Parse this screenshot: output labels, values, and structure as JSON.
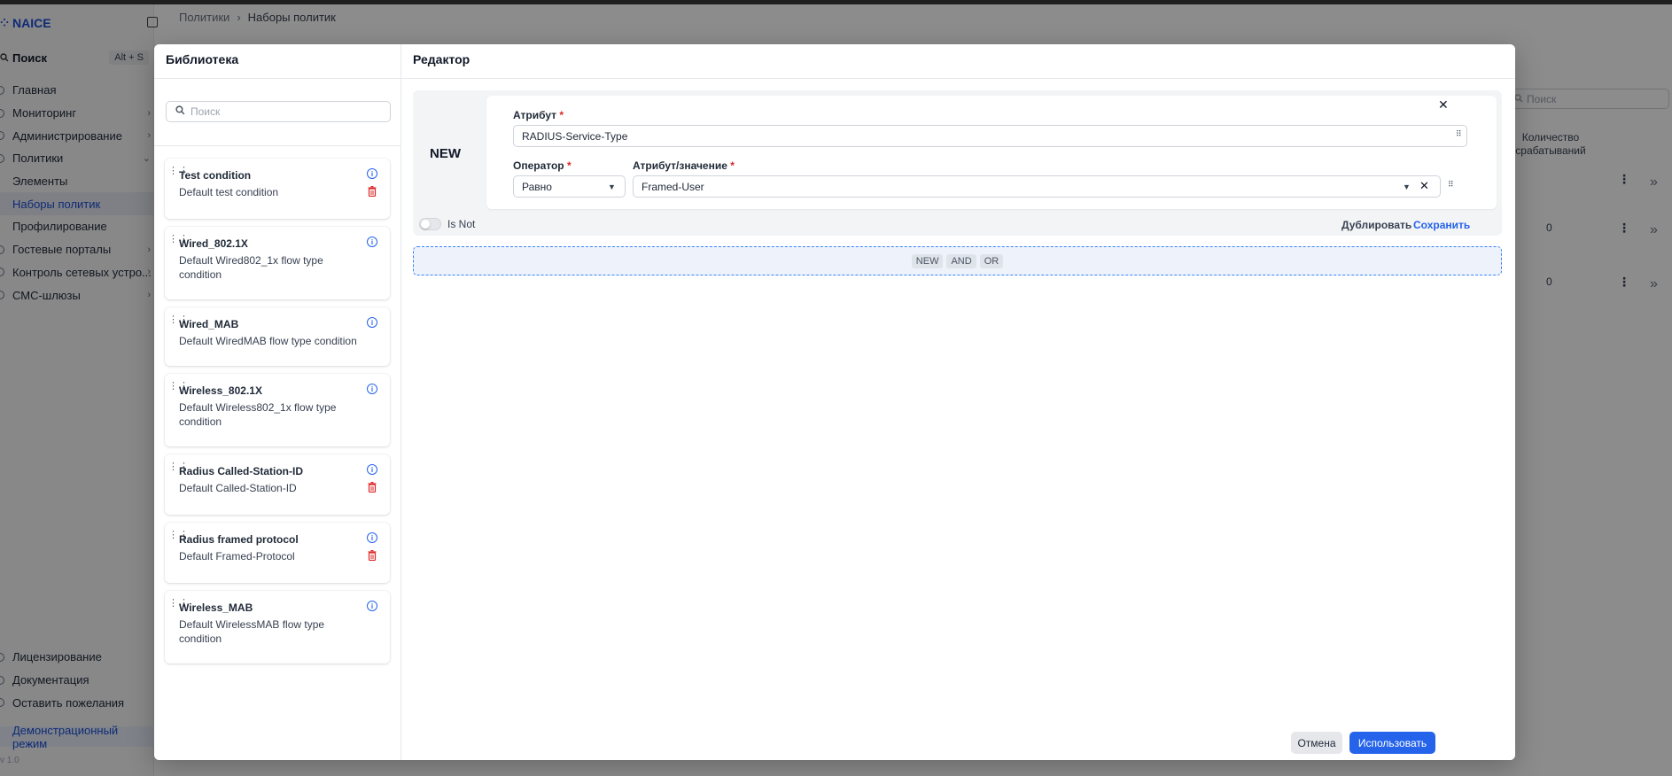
{
  "app": {
    "brand": "NAICE",
    "search_label": "Поиск",
    "search_shortcut": "Alt + S",
    "nav": [
      {
        "label": "Главная"
      },
      {
        "label": "Мониторинг"
      },
      {
        "label": "Администрирование"
      },
      {
        "label": "Политики"
      },
      {
        "label": "Элементы"
      },
      {
        "label": "Наборы политик"
      },
      {
        "label": "Профилирование"
      },
      {
        "label": "Гостевые порталы"
      },
      {
        "label": "Контроль сетевых устро..."
      },
      {
        "label": "СМС-шлюзы"
      }
    ],
    "nav_bottom": [
      {
        "label": "Лицензирование"
      },
      {
        "label": "Документация"
      },
      {
        "label": "Оставить пожелания"
      }
    ],
    "demo_mode": "Демонстрационный режим",
    "version": "v 1.0"
  },
  "breadcrumb": {
    "root": "Политики",
    "current": "Наборы политик"
  },
  "background_table": {
    "search_placeholder": "Поиск",
    "col_header": "Количество срабатываний",
    "values": [
      "0",
      "0"
    ]
  },
  "library": {
    "title": "Библиотека",
    "search_placeholder": "Поиск",
    "items": [
      {
        "title": "Test condition",
        "desc": "Default test condition"
      },
      {
        "title": "Wired_802.1X",
        "desc": "Default Wired802_1x flow type condition"
      },
      {
        "title": "Wired_MAB",
        "desc": "Default WiredMAB flow type condition"
      },
      {
        "title": "Wireless_802.1X",
        "desc": "Default Wireless802_1x flow type condition"
      },
      {
        "title": "Radius Called-Station-ID",
        "desc": "Default Called-Station-ID"
      },
      {
        "title": "Radius framed protocol",
        "desc": "Default Framed-Protocol"
      },
      {
        "title": "Wireless_MAB",
        "desc": "Default WirelessMAB flow type condition"
      }
    ]
  },
  "editor": {
    "title": "Редактор",
    "new_label": "NEW",
    "attribute_label": "Атрибут",
    "attribute_value": "RADIUS-Service-Type",
    "operator_label": "Оператор",
    "operator_value": "Равно",
    "attr_value_label": "Атрибут/значение",
    "attr_value_value": "Framed-User",
    "required_mark": "*",
    "is_not": "Is Not",
    "duplicate": "Дублировать",
    "save": "Сохранить",
    "chips": [
      "NEW",
      "AND",
      "OR"
    ]
  },
  "footer": {
    "cancel": "Отмена",
    "use": "Использовать"
  },
  "colors": {
    "accent": "#2563eb",
    "danger": "#dc2626"
  }
}
